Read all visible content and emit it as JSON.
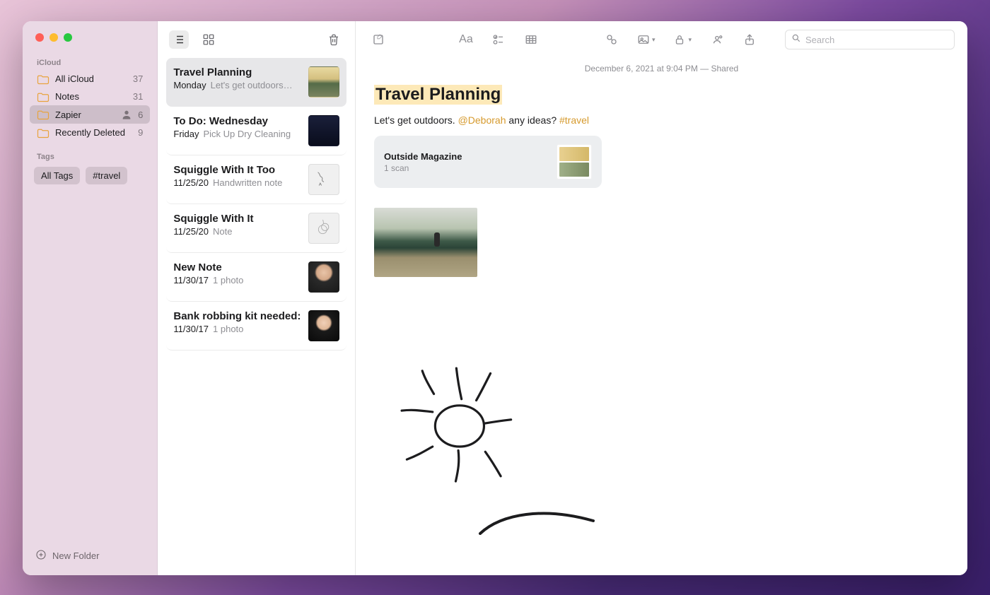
{
  "sidebar": {
    "section_label": "iCloud",
    "folders": [
      {
        "name": "All iCloud",
        "count": "37",
        "shared": false
      },
      {
        "name": "Notes",
        "count": "31",
        "shared": false
      },
      {
        "name": "Zapier",
        "count": "6",
        "shared": true
      },
      {
        "name": "Recently Deleted",
        "count": "9",
        "shared": false
      }
    ],
    "tags_label": "Tags",
    "tags": [
      "All Tags",
      "#travel"
    ],
    "new_folder_label": "New Folder"
  },
  "notes": [
    {
      "title": "Travel Planning",
      "date": "Monday",
      "preview": "Let's get outdoors…",
      "thumb": "landscape"
    },
    {
      "title": "To Do: Wednesday",
      "date": "Friday",
      "preview": "Pick Up Dry Cleaning",
      "thumb": "dark"
    },
    {
      "title": "Squiggle With It Too",
      "date": "11/25/20",
      "preview": "Handwritten note",
      "thumb": "squiggle1"
    },
    {
      "title": "Squiggle With It",
      "date": "11/25/20",
      "preview": "Note",
      "thumb": "squiggle2"
    },
    {
      "title": "New Note",
      "date": "11/30/17",
      "preview": "1 photo",
      "thumb": "face"
    },
    {
      "title": "Bank robbing kit needed:",
      "date": "11/30/17",
      "preview": "1 photo",
      "thumb": "face2"
    }
  ],
  "editor": {
    "meta": "December 6, 2021 at 9:04 PM — Shared",
    "title": "Travel Planning",
    "body_prefix": "Let's get outdoors. ",
    "mention": "@Deborah",
    "body_mid": " any ideas? ",
    "hashtag": "#travel",
    "attachment": {
      "title": "Outside Magazine",
      "sub": "1 scan"
    },
    "search_placeholder": "Search"
  }
}
